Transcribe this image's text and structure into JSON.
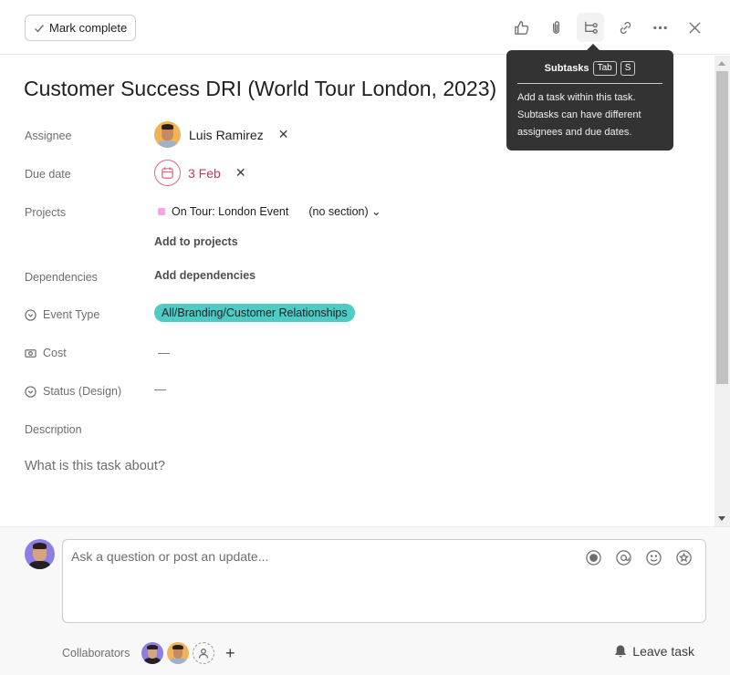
{
  "toolbar": {
    "mark_complete_label": "Mark complete",
    "icons": [
      "like-icon",
      "attachment-icon",
      "subtasks-icon",
      "link-icon",
      "more-icon",
      "close-icon"
    ]
  },
  "tooltip": {
    "title": "Subtasks",
    "shortcut_keys": [
      "Tab",
      "S"
    ],
    "body": "Add a task within this task. Subtasks can have different assignees and due dates."
  },
  "task": {
    "title": "Customer Success DRI (World Tour London, 2023)",
    "fields": {
      "assignee": {
        "label": "Assignee",
        "value": "Luis Ramirez"
      },
      "due_date": {
        "label": "Due date",
        "value": "3 Feb",
        "color": "#c9365a"
      },
      "projects": {
        "label": "Projects",
        "project": "On Tour: London Event",
        "section": "(no section)",
        "project_color": "#f3a6e6",
        "add_label": "Add to projects"
      },
      "dependencies": {
        "label": "Dependencies",
        "add_label": "Add dependencies"
      },
      "event_type": {
        "label": "Event Type",
        "value": "All/Branding/Customer Relationships",
        "pill_color": "#4ecbc4"
      },
      "cost": {
        "label": "Cost",
        "value": "—"
      },
      "status_design": {
        "label": "Status (Design)",
        "value": "—"
      },
      "description": {
        "label": "Description",
        "placeholder": "What is this task about?"
      }
    }
  },
  "comment": {
    "placeholder": "Ask a question or post an update...",
    "icons": [
      "record-icon",
      "mention-icon",
      "emoji-icon",
      "appreciation-icon"
    ]
  },
  "collaborators": {
    "label": "Collaborators",
    "people": [
      "Current user",
      "Luis Ramirez"
    ],
    "add_label": "+"
  },
  "leave_task_label": "Leave task"
}
